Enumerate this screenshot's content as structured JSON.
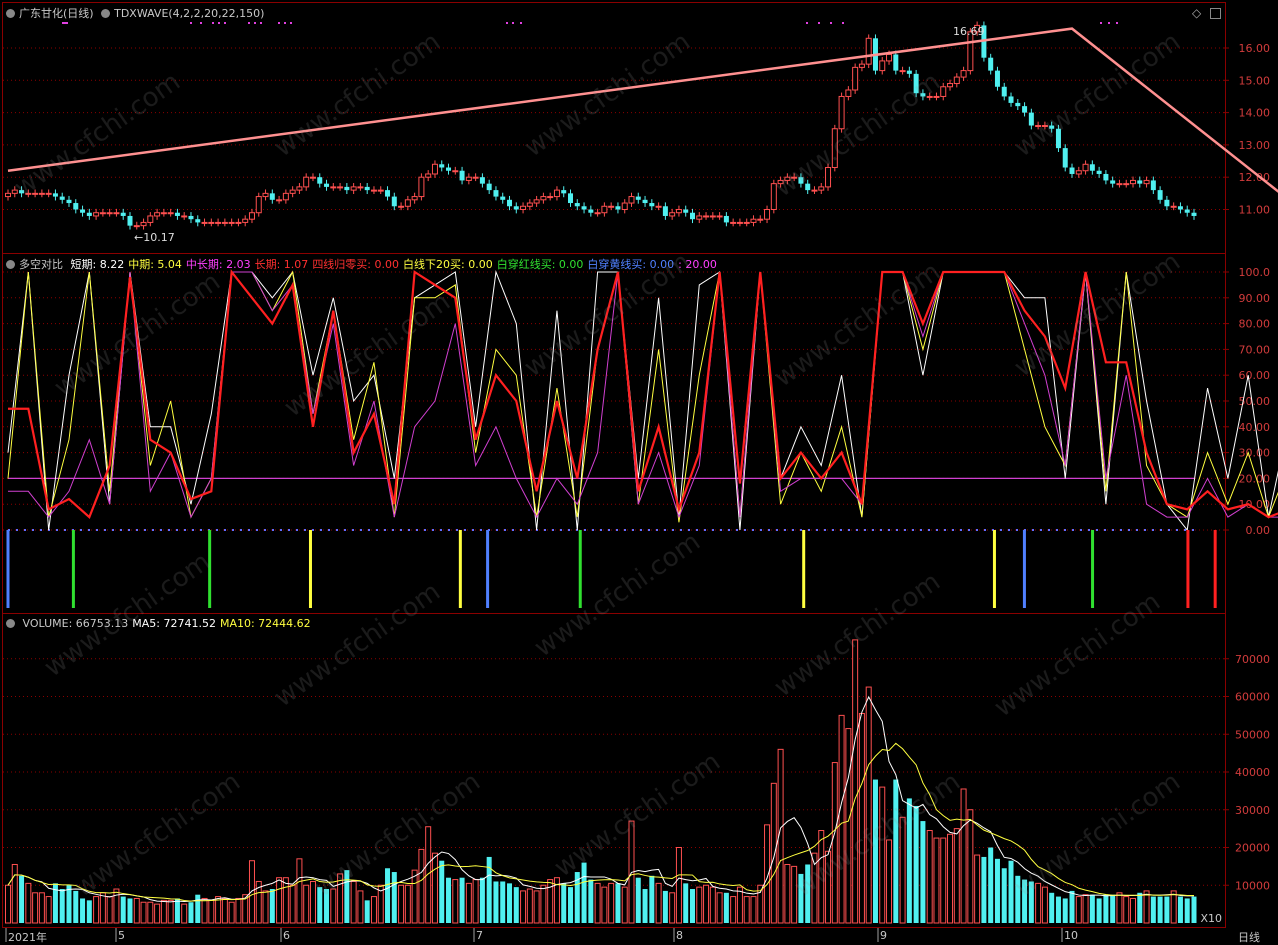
{
  "price_panel": {
    "stock_title": "广东甘化(日线)",
    "indicator_title": "TDXWAVE(4,2,2,20,22,150)",
    "high_label": "16.69",
    "low_label": "←10.17",
    "yticks": [
      "16.00",
      "15.00",
      "14.00",
      "13.00",
      "12.00",
      "11.00"
    ]
  },
  "osc_panel": {
    "title": "多空对比",
    "items": [
      {
        "label": "短期: 8.22",
        "color": "#ffffff"
      },
      {
        "label": "中期: 5.04",
        "color": "#ffff40"
      },
      {
        "label": "中长期: 2.03",
        "color": "#ff40ff"
      },
      {
        "label": "长期: 1.07",
        "color": "#ff3030"
      },
      {
        "label": "四线归零买: 0.00",
        "color": "#ff3030"
      },
      {
        "label": "白线下20买: 0.00",
        "color": "#ffff40"
      },
      {
        "label": "白穿红线买: 0.00",
        "color": "#30e030"
      },
      {
        "label": "白穿黄线买: 0.00",
        "color": "#5080ff"
      },
      {
        "label": ": 20.00",
        "color": "#ff40ff"
      }
    ],
    "yticks": [
      "100.0",
      "90.00",
      "80.00",
      "70.00",
      "60.00",
      "50.00",
      "40.00",
      "30.00",
      "20.00",
      "10.00",
      "0.00"
    ]
  },
  "vol_panel": {
    "items": [
      {
        "label": "VOLUME: 66753.13",
        "color": "#c8c8c8"
      },
      {
        "label": "MA5: 72741.52",
        "color": "#ffffff"
      },
      {
        "label": "MA10: 72444.62",
        "color": "#ffff40"
      }
    ],
    "yticks": [
      "70000",
      "60000",
      "50000",
      "40000",
      "30000",
      "20000",
      "10000"
    ],
    "unit": "X10"
  },
  "xaxis": {
    "labels": [
      "2021年",
      "5",
      "6",
      "7",
      "8",
      "9",
      "10"
    ],
    "period": "日线"
  },
  "watermark": "www.cfchi.com",
  "colors": {
    "up": "#ff5050",
    "down": "#50f0f0",
    "trend": "#ff9090",
    "grid": "#8a0000",
    "axis_text": "#d23c3c"
  },
  "chart_data": [
    {
      "type": "candlestick",
      "title": "广东甘化(日线)",
      "ylim": [
        10.17,
        16.69
      ],
      "high": 16.69,
      "low": 10.17,
      "trend_line_points": [
        [
          0,
          12.2
        ],
        [
          157,
          16.6
        ],
        [
          192,
          10.8
        ]
      ],
      "close": [
        11.5,
        11.6,
        11.5,
        11.5,
        11.5,
        11.5,
        11.5,
        11.4,
        11.3,
        11.2,
        11.0,
        10.9,
        10.8,
        10.9,
        10.9,
        10.9,
        10.9,
        10.8,
        10.5,
        10.5,
        10.6,
        10.8,
        10.9,
        10.9,
        10.9,
        10.8,
        10.8,
        10.7,
        10.6,
        10.6,
        10.6,
        10.6,
        10.6,
        10.6,
        10.6,
        10.7,
        10.9,
        11.4,
        11.5,
        11.3,
        11.3,
        11.5,
        11.6,
        11.7,
        12.0,
        12.0,
        11.8,
        11.7,
        11.7,
        11.7,
        11.6,
        11.7,
        11.7,
        11.6,
        11.6,
        11.6,
        11.4,
        11.1,
        11.1,
        11.3,
        11.4,
        12.0,
        12.1,
        12.4,
        12.3,
        12.2,
        12.2,
        11.9,
        12.0,
        12.0,
        11.8,
        11.6,
        11.4,
        11.3,
        11.1,
        11.0,
        11.1,
        11.2,
        11.3,
        11.4,
        11.4,
        11.6,
        11.5,
        11.2,
        11.1,
        11.0,
        10.9,
        10.9,
        11.1,
        11.1,
        11.0,
        11.2,
        11.4,
        11.3,
        11.2,
        11.1,
        11.1,
        10.8,
        10.9,
        11.0,
        10.9,
        10.7,
        10.8,
        10.8,
        10.8,
        10.8,
        10.6,
        10.6,
        10.6,
        10.6,
        10.7,
        10.7,
        11.0,
        11.8,
        11.9,
        12.0,
        12.0,
        11.8,
        11.6,
        11.6,
        11.7,
        12.3,
        13.5,
        14.5,
        14.7,
        15.4,
        15.5,
        16.3,
        15.3,
        15.6,
        15.8,
        15.3,
        15.3,
        15.2,
        14.6,
        14.5,
        14.5,
        14.5,
        14.8,
        14.9,
        15.1,
        15.3,
        16.5,
        16.7,
        15.7,
        15.3,
        14.8,
        14.5,
        14.3,
        14.2,
        14.0,
        13.6,
        13.6,
        13.6,
        13.5,
        12.9,
        12.3,
        12.1,
        12.2,
        12.4,
        12.2,
        12.1,
        11.9,
        11.8,
        11.8,
        11.8,
        11.9,
        11.8,
        11.9,
        11.6,
        11.3,
        11.1,
        11.1,
        11.0,
        10.9,
        10.8
      ],
      "volume": [
        10000,
        15500,
        12500,
        10500,
        8000,
        8000,
        7000,
        10500,
        9000,
        10000,
        8500,
        6500,
        6000,
        7000,
        8000,
        7000,
        9000,
        7000,
        6500,
        6500,
        5500,
        5500,
        5000,
        6000,
        6000,
        6500,
        5000,
        5500,
        7500,
        6500,
        6000,
        7000,
        6500,
        5500,
        6500,
        7500,
        16500,
        11000,
        8500,
        9000,
        12000,
        12000,
        10000,
        17000,
        10000,
        11000,
        9500,
        9000,
        9000,
        13000,
        14000,
        11000,
        8500,
        6000,
        7000,
        10000,
        14500,
        13500,
        10000,
        10000,
        14000,
        19500,
        25500,
        18500,
        16500,
        12000,
        11500,
        12000,
        10500,
        11500,
        12000,
        17500,
        11000,
        11000,
        10500,
        9500,
        8500,
        9000,
        8500,
        10000,
        11500,
        12000,
        10500,
        9500,
        13500,
        16000,
        11500,
        10500,
        9500,
        10500,
        10500,
        9500,
        27000,
        12000,
        9000,
        12500,
        10500,
        8500,
        8000,
        20000,
        10500,
        9000,
        9500,
        10000,
        9500,
        8000,
        8000,
        7000,
        9500,
        7000,
        7000,
        10000,
        26000,
        37000,
        46000,
        15500,
        15000,
        13000,
        15500,
        18500,
        24500,
        19000,
        42500,
        55000,
        51500,
        75000,
        55500,
        62500,
        38000,
        36000,
        22000,
        38000,
        28000,
        33000,
        31000,
        27000,
        24500,
        22500,
        22500,
        23500,
        25000,
        35500,
        30000,
        18000,
        17500,
        20000,
        17000,
        14500,
        16500,
        12500,
        11500,
        11000,
        10500,
        9500,
        8000,
        7000,
        6500,
        8500,
        7000,
        7500,
        7500,
        6500,
        7500,
        7500,
        8000,
        7000,
        6500,
        8000,
        8500,
        7000,
        7000,
        7000,
        8500,
        7000,
        6500,
        7000
      ],
      "ylabel": "X10"
    },
    {
      "type": "line",
      "title": "多空对比",
      "ylim": [
        0,
        100
      ],
      "x": [
        0,
        3,
        6,
        9,
        12,
        15,
        18,
        21,
        24,
        27,
        30,
        33,
        36,
        39,
        42,
        45,
        48,
        51,
        54,
        57,
        60,
        63,
        66,
        69,
        72,
        75,
        78,
        81,
        84,
        87,
        90,
        93,
        96,
        99,
        102,
        105,
        108,
        111,
        114,
        117,
        120,
        123,
        126,
        129,
        132,
        135,
        138,
        141,
        144,
        147,
        150,
        153,
        156,
        159,
        162,
        165,
        168,
        171,
        174,
        177,
        180,
        183,
        186,
        189,
        192
      ],
      "series": [
        {
          "name": "短期",
          "values": [
            30,
            100,
            0,
            60,
            100,
            10,
            100,
            40,
            40,
            10,
            45,
            100,
            100,
            90,
            100,
            60,
            90,
            50,
            60,
            20,
            90,
            95,
            100,
            40,
            100,
            80,
            0,
            85,
            0,
            100,
            100,
            20,
            90,
            5,
            95,
            100,
            0,
            100,
            20,
            40,
            25,
            60,
            5,
            100,
            100,
            60,
            100,
            100,
            100,
            100,
            90,
            90,
            20,
            100,
            10,
            100,
            50,
            10,
            0,
            55,
            20,
            60,
            5,
            42,
            0
          ]
        },
        {
          "name": "中期",
          "values": [
            20,
            100,
            5,
            35,
            100,
            15,
            100,
            25,
            50,
            5,
            20,
            100,
            100,
            85,
            100,
            45,
            85,
            35,
            65,
            5,
            90,
            90,
            95,
            30,
            70,
            60,
            5,
            55,
            5,
            70,
            100,
            10,
            70,
            3,
            60,
            100,
            5,
            100,
            10,
            30,
            15,
            40,
            5,
            100,
            100,
            70,
            100,
            100,
            100,
            100,
            70,
            40,
            25,
            100,
            15,
            100,
            25,
            10,
            5,
            30,
            10,
            30,
            5,
            25,
            0
          ]
        },
        {
          "name": "中长期",
          "values": [
            15,
            15,
            5,
            15,
            35,
            10,
            100,
            15,
            30,
            5,
            20,
            100,
            100,
            85,
            95,
            45,
            80,
            25,
            50,
            5,
            40,
            50,
            80,
            25,
            40,
            20,
            5,
            20,
            10,
            30,
            100,
            10,
            30,
            5,
            25,
            100,
            5,
            100,
            15,
            20,
            20,
            20,
            10,
            100,
            100,
            75,
            100,
            100,
            100,
            100,
            80,
            60,
            25,
            100,
            20,
            60,
            10,
            5,
            5,
            20,
            5,
            10,
            5,
            5,
            0
          ]
        },
        {
          "name": "长期",
          "values": [
            47,
            47,
            8,
            12,
            5,
            25,
            98,
            35,
            30,
            12,
            15,
            100,
            90,
            80,
            95,
            40,
            85,
            30,
            45,
            10,
            100,
            95,
            90,
            35,
            60,
            50,
            15,
            50,
            20,
            70,
            100,
            15,
            40,
            8,
            30,
            100,
            18,
            100,
            20,
            30,
            20,
            30,
            10,
            100,
            100,
            80,
            100,
            100,
            100,
            100,
            85,
            75,
            55,
            100,
            65,
            65,
            30,
            10,
            8,
            15,
            8,
            10,
            5,
            8,
            1
          ]
        }
      ],
      "reference_line": 20.0,
      "ylabel": ""
    }
  ]
}
